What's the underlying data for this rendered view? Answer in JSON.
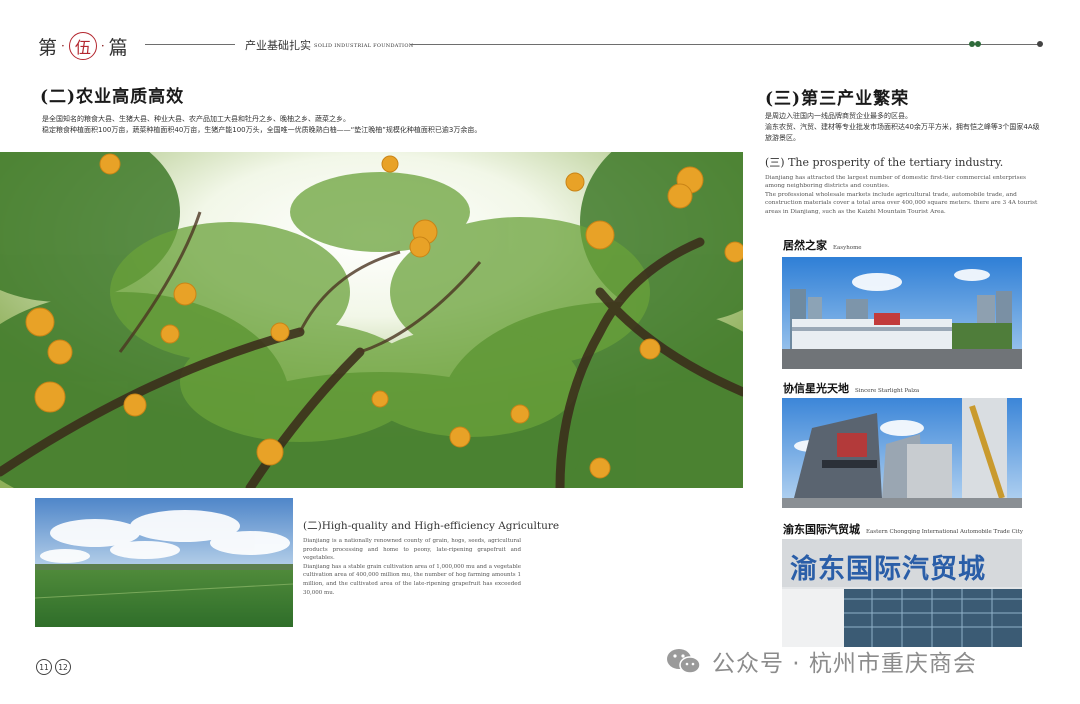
{
  "header": {
    "chapter_prefix": "第",
    "chapter_number": "伍",
    "chapter_suffix": "篇",
    "dot": "·",
    "section_zh": "产业基础扎实",
    "section_en": "SOLID INDUSTRIAL FOUNDATION"
  },
  "left": {
    "heading": "(二)农业高质高效",
    "zh_line1": "是全国知名的粮食大县、生猪大县、种业大县、农产品加工大县和牡丹之乡、晚柚之乡、蔬菜之乡。",
    "zh_line2": "稳定粮食种植面积100万亩，蔬菜种植面积40万亩，生猪产能100万头，全国唯一优质晚熟白柚——“垫江晚柚”规模化种植面积已逾3万余亩。",
    "en_title": "(二)High-quality and High-efficiency Agriculture",
    "en_para1": "Dianjiang is a nationally renowned county of grain, hogs, seeds, agricultural products processing and home to peony, late-ripening grapefruit and vegetables.",
    "en_para2": "Dianjiang has a stable grain cultivation area of 1,000,000 mu and a vegetable cultivation area of 400,000 million mu, the number of hog farming amounts 1 million, and the cultivated area of the late-ripening grapefruit has exceeded 30,000 mu."
  },
  "right": {
    "heading": "(三)第三产业繁荣",
    "zh_line1": "是周边入驻国内一线品牌商贸企业最多的区县。",
    "zh_line2": "渝东农贸、汽贸、建材等专业批发市场面积达40余万平方米，拥有恺之峰等3个国家4A级旅游景区。",
    "en_title": "(三) The prosperity of the tertiary industry.",
    "en_para1": "Dianjiang has attracted the largest number of domestic first-tier commercial enterprises among neighboring districts and counties.",
    "en_para2": "The professional wholesale markets include agricultural trade, automobile trade, and construction materials cover a total area over 400,000 square meters. there are 3 4A tourist areas in Dianjiang, such as the Kaizhi Mountain Tourist Area.",
    "photos": [
      {
        "zh": "居然之家",
        "en": "Easyhome"
      },
      {
        "zh": "协信星光天地",
        "en": "Sincere Starlight Palza"
      },
      {
        "zh": "渝东国际汽贸城",
        "en": "Eastern Chongqing International Automobile Trade City"
      }
    ],
    "sign_text": "渝东国际汽贸城"
  },
  "pages": [
    "11",
    "12"
  ],
  "watermark": "公众号 · 杭州市重庆商会",
  "colors": {
    "accent_red": "#b3262e",
    "dot_green": "#2e6b3a"
  }
}
